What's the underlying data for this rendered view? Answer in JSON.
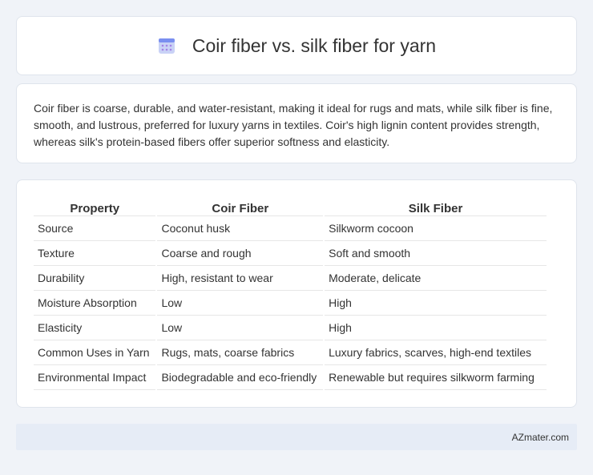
{
  "header": {
    "title": "Coir fiber vs. silk fiber for yarn",
    "icon": "calendar-icon",
    "icon_colors": {
      "body": "#c9d2f6",
      "top": "#7a8ff0",
      "dots": "#a483e6"
    }
  },
  "summary": {
    "text": "Coir fiber is coarse, durable, and water-resistant, making it ideal for rugs and mats, while silk fiber is fine, smooth, and lustrous, preferred for luxury yarns in textiles. Coir's high lignin content provides strength, whereas silk's protein-based fibers offer superior softness and elasticity."
  },
  "table": {
    "headers": [
      "Property",
      "Coir Fiber",
      "Silk Fiber"
    ],
    "rows": [
      [
        "Source",
        "Coconut husk",
        "Silkworm cocoon"
      ],
      [
        "Texture",
        "Coarse and rough",
        "Soft and smooth"
      ],
      [
        "Durability",
        "High, resistant to wear",
        "Moderate, delicate"
      ],
      [
        "Moisture Absorption",
        "Low",
        "High"
      ],
      [
        "Elasticity",
        "Low",
        "High"
      ],
      [
        "Common Uses in Yarn",
        "Rugs, mats, coarse fabrics",
        "Luxury fabrics, scarves, high-end textiles"
      ],
      [
        "Environmental Impact",
        "Biodegradable and eco-friendly",
        "Renewable but requires silkworm farming"
      ]
    ]
  },
  "footer": {
    "text": "AZmater.com"
  }
}
